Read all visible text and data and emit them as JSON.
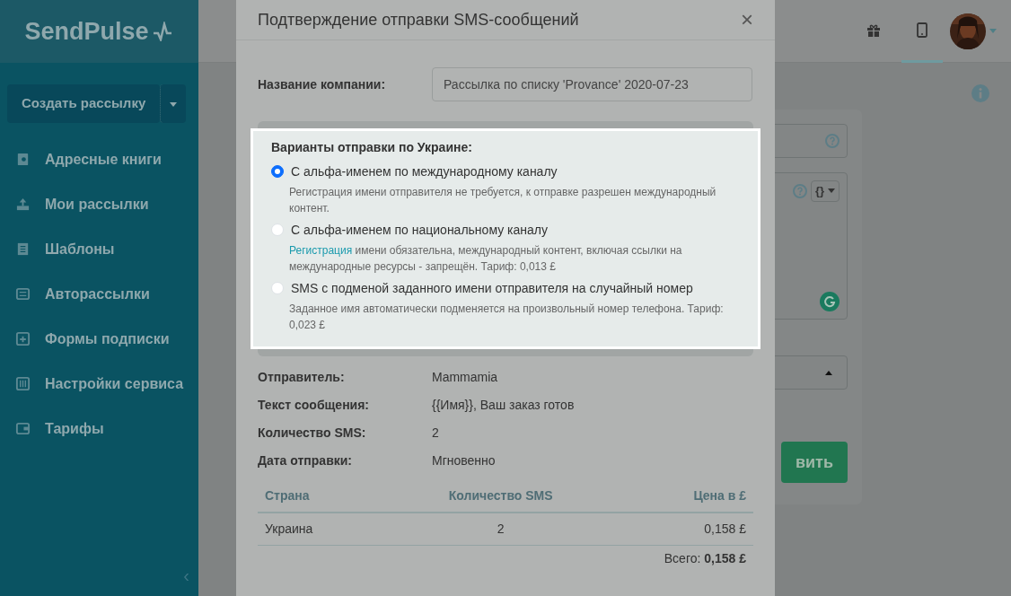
{
  "sidebar": {
    "logo": "SendPulse",
    "create_button": "Создать рассылку",
    "items": [
      {
        "kind": "book",
        "label": "Адресные книги"
      },
      {
        "kind": "upload",
        "label": "Мои рассылки"
      },
      {
        "kind": "template",
        "label": "Шаблоны"
      },
      {
        "kind": "auto",
        "label": "Авторассылки"
      },
      {
        "kind": "form",
        "label": "Формы подписки"
      },
      {
        "kind": "settings",
        "label": "Настройки сервиса"
      },
      {
        "kind": "wallet",
        "label": "Тарифы"
      }
    ],
    "collapse": "‹"
  },
  "topbar": {
    "tabs": [
      {
        "kind": "gift",
        "selected": false
      },
      {
        "kind": "phone",
        "selected": true
      }
    ]
  },
  "background": {
    "variable_button": "{}",
    "button": "вить"
  },
  "modal": {
    "title": "Подтверждение отправки SMS-сообщений",
    "close": "×",
    "company_label": "Название компании:",
    "company_value": "Рассылка по списку 'Provance' 2020-07-23",
    "options_title": "Варианты отправки по Украине:",
    "options": [
      {
        "label": "С альфа-именем по международному каналу",
        "selected": true,
        "description": "Регистрация имени отправителя не требуется, к отправке разрешен международный контент."
      },
      {
        "label": "С альфа-именем по национальному каналу",
        "selected": false,
        "link": "Регистрация",
        "description": "имени обязательна, международный контент, включая ссылки на международные ресурсы - запрещён. Тариф: 0,013 £"
      },
      {
        "label": "SMS с подменой заданного имени отправителя на случайный номер",
        "selected": false,
        "description": "Заданное имя автоматически подменяется на произвольный номер телефона. Тариф: 0,023 £"
      }
    ],
    "details": [
      {
        "label": "Отправитель:",
        "value": "Mammamia"
      },
      {
        "label": "Текст сообщения:",
        "value": "{{Имя}}, Ваш заказ готов"
      },
      {
        "label": "Количество SMS:",
        "value": "2"
      },
      {
        "label": "Дата отправки:",
        "value": "Мгновенно"
      }
    ],
    "table": {
      "columns": [
        "Страна",
        "Количество SMS",
        "Цена в £"
      ],
      "rows": [
        [
          "Украина",
          "2",
          "0,158 £"
        ]
      ]
    },
    "total": "Всего: **0,158 £**"
  }
}
